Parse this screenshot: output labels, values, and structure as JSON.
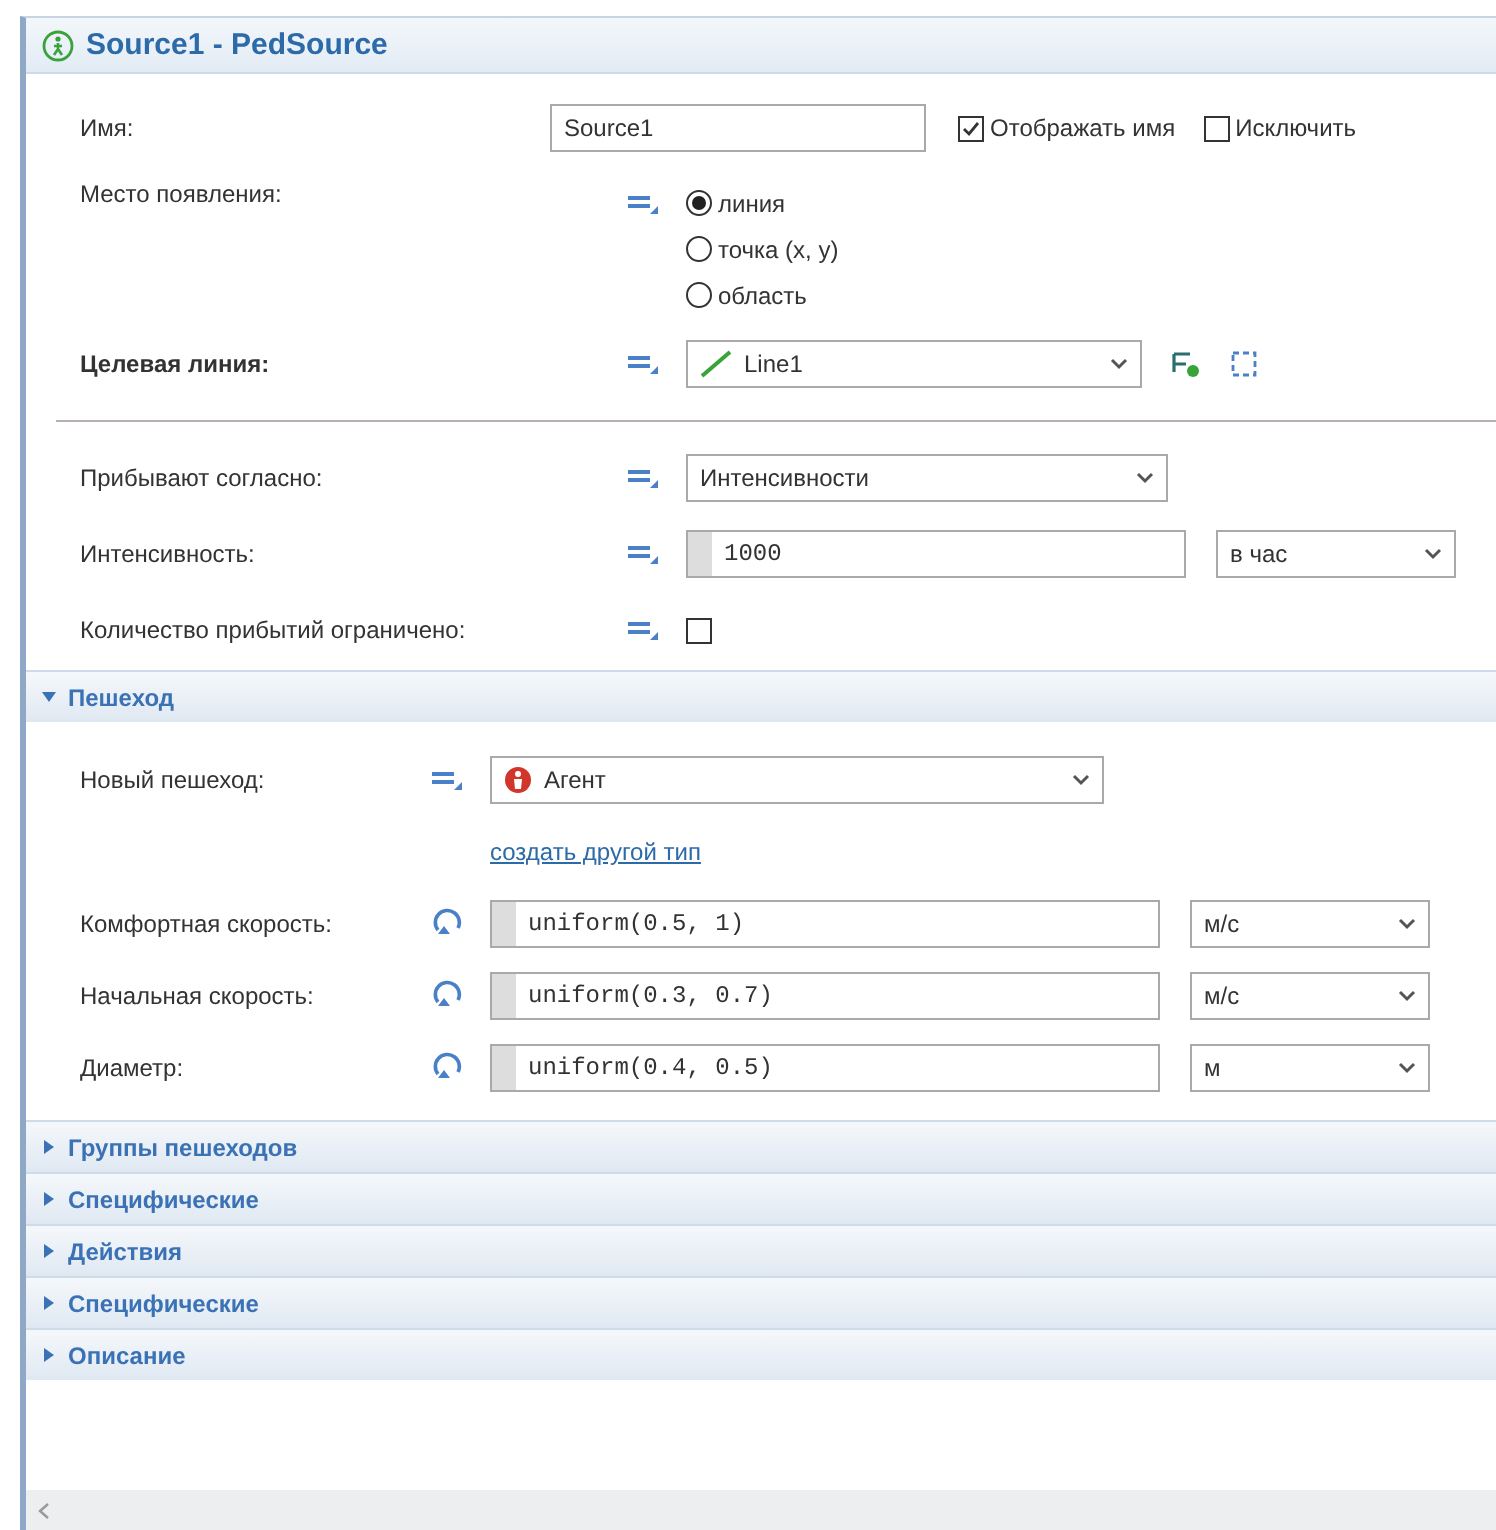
{
  "title": "Source1 - PedSource",
  "general_rows": [
    {
      "kind": "name",
      "label": "Имя:",
      "bold": false,
      "value": "Source1",
      "checkboxes": [
        {
          "label": "Отображать имя",
          "checked": true
        },
        {
          "label": "Исключить",
          "checked": false
        }
      ]
    },
    {
      "kind": "radio",
      "label": "Место появления:",
      "bold": false,
      "dynamic": false,
      "options": [
        {
          "label": "линия",
          "selected": true
        },
        {
          "label": "точка (x, y)",
          "selected": false
        },
        {
          "label": "область",
          "selected": false
        }
      ]
    },
    {
      "kind": "dropdown",
      "label": "Целевая линия:",
      "bold": true,
      "dynamic": false,
      "value": "Line1",
      "icon": {
        "kind": "line"
      },
      "tools": true
    },
    {
      "kind": "separator"
    },
    {
      "kind": "dropdown",
      "label": "Прибывают согласно:",
      "bold": false,
      "dynamic": false,
      "value": "Интенсивности",
      "tools": false
    },
    {
      "kind": "expression",
      "label": "Интенсивность:",
      "bold": false,
      "dynamic": false,
      "value": "1000",
      "unit": "в час"
    },
    {
      "kind": "checkbox",
      "label": "Количество прибытий ограничено:",
      "bold": false,
      "dynamic": false,
      "checked": false
    }
  ],
  "sections": [
    {
      "label": "Пешеход",
      "expanded": true,
      "rows": [
        {
          "kind": "dropdown",
          "label": "Новый пешеход:",
          "bold": false,
          "dynamic": false,
          "value": "Агент",
          "icon": {
            "kind": "agent"
          },
          "tools": false
        },
        {
          "kind": "link",
          "text": "создать другой тип"
        },
        {
          "kind": "expression",
          "label": "Комфортная скорость:",
          "bold": false,
          "dynamic": true,
          "value": "uniform(0.5, 1)",
          "unit": "м/с"
        },
        {
          "kind": "expression",
          "label": "Начальная скорость:",
          "bold": false,
          "dynamic": true,
          "value": "uniform(0.3, 0.7)",
          "unit": "м/с"
        },
        {
          "kind": "expression",
          "label": "Диаметр:",
          "bold": false,
          "dynamic": true,
          "value": "uniform(0.4, 0.5)",
          "unit": "м"
        }
      ]
    },
    {
      "label": "Группы пешеходов",
      "expanded": false
    },
    {
      "label": "Специфические",
      "expanded": false
    },
    {
      "label": "Действия",
      "expanded": false
    },
    {
      "label": "Специфические",
      "expanded": false
    },
    {
      "label": "Описание",
      "expanded": false
    }
  ]
}
